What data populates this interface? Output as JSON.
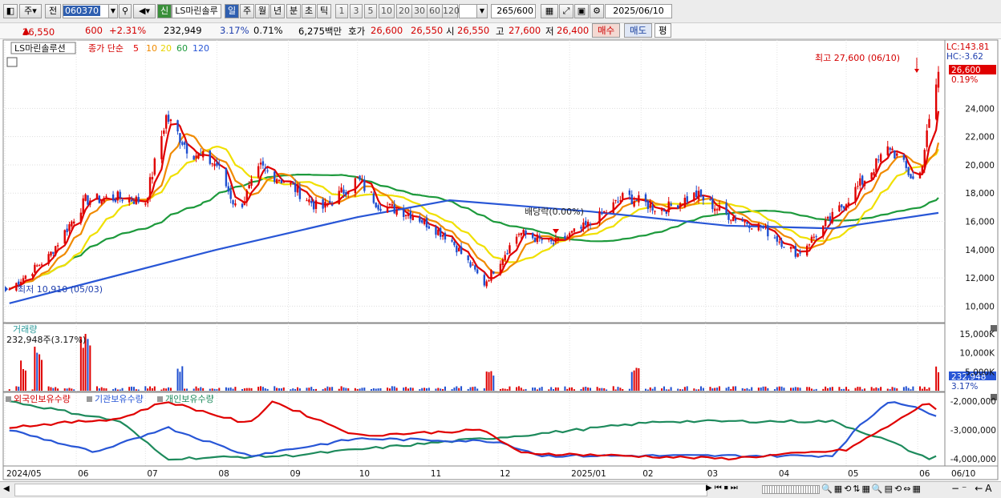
{
  "toolbar": {
    "period": "주",
    "prev": "전",
    "code": "060370",
    "new_badge": "신",
    "stock_name": "LS마린솔루",
    "tf_day": "일",
    "tf_week": "주",
    "tf_month": "월",
    "tf_year": "년",
    "tf_min": "분",
    "tf_sec": "초",
    "tf_tick": "틱",
    "nums": [
      "1",
      "3",
      "5",
      "10",
      "20",
      "30",
      "60",
      "120"
    ],
    "count": "265",
    "count_total": "/600",
    "date": "2025/06/10"
  },
  "quote": {
    "price": "26,550",
    "change": "600",
    "change_pct": "+2.31%",
    "volume": "232,949",
    "vol_pct": "3.17%",
    "turnover": "0.71%",
    "amount": "6,275백만",
    "bid_label": "호가",
    "bid1": "26,600",
    "bid2": "26,550",
    "open_label": "시",
    "open": "26,550",
    "high_label": "고",
    "high": "27,600",
    "low_label": "저",
    "low": "26,400",
    "buy": "매수",
    "sell": "매도",
    "eval": "평"
  },
  "price_pane": {
    "title": "LS마린솔루션",
    "ma_label": "종가 단순",
    "ma_periods": [
      "5",
      "10",
      "20",
      "60",
      "120"
    ],
    "lc": "LC:143.81",
    "hc": "HC:-3.62",
    "last_price": "26,600",
    "last_pct": "0.19%",
    "max_note": "최고 27,600 (06/10)",
    "min_note": "최저 10,910 (05/03)",
    "dividend_note": "배당락(0.00%)",
    "y_ticks": [
      "24,000",
      "22,000",
      "20,000",
      "18,000",
      "16,000",
      "14,000",
      "12,000",
      "10,000"
    ]
  },
  "volume_pane": {
    "title": "거래량",
    "value": "232,948주(3.17%)",
    "y_ticks": [
      "15,000K",
      "10,000K",
      "5,000K"
    ],
    "last": "232,948",
    "last_pct": "3.17%"
  },
  "holdings_pane": {
    "legend": [
      "외국인보유수량",
      "기관보유수량",
      "개인보유수량"
    ],
    "y_ticks": [
      "-2,000,000",
      "-3,000,000",
      "-4,000,000"
    ]
  },
  "x_axis": [
    "2024/05",
    "06",
    "07",
    "08",
    "09",
    "10",
    "11",
    "12",
    "2025/01",
    "02",
    "03",
    "04",
    "05",
    "06",
    "06/10"
  ],
  "colors": {
    "up": "#e00000",
    "down": "#1f4fd0",
    "ma5": "#e00000",
    "ma10": "#f08a00",
    "ma20": "#f0e000",
    "ma60": "#1d9a3c",
    "ma120": "#2856d6",
    "foreign": "#e00000",
    "institution": "#2856d6",
    "individual": "#1d8a5c"
  },
  "chart_data": {
    "type": "line",
    "x_range": [
      "2024/05",
      "2025/06/10"
    ],
    "price_ylim": [
      9000,
      28500
    ],
    "close_series": [
      [
        "2024-05-03",
        11200
      ],
      [
        "2024-05-20",
        13500
      ],
      [
        "2024-06-05",
        17500
      ],
      [
        "2024-06-20",
        17700
      ],
      [
        "2024-07-01",
        17400
      ],
      [
        "2024-07-10",
        23400
      ],
      [
        "2024-07-20",
        21000
      ],
      [
        "2024-08-01",
        20000
      ],
      [
        "2024-08-10",
        16700
      ],
      [
        "2024-08-20",
        19800
      ],
      [
        "2024-09-01",
        18700
      ],
      [
        "2024-09-15",
        16800
      ],
      [
        "2024-10-01",
        19000
      ],
      [
        "2024-10-10",
        17200
      ],
      [
        "2024-10-25",
        16500
      ],
      [
        "2024-11-10",
        14800
      ],
      [
        "2024-11-25",
        11600
      ],
      [
        "2024-12-10",
        15200
      ],
      [
        "2024-12-25",
        14400
      ],
      [
        "2025-01-10",
        15800
      ],
      [
        "2025-01-25",
        17800
      ],
      [
        "2025-02-10",
        16800
      ],
      [
        "2025-02-25",
        17900
      ],
      [
        "2025-03-10",
        16500
      ],
      [
        "2025-03-25",
        15600
      ],
      [
        "2025-04-10",
        13700
      ],
      [
        "2025-04-25",
        16300
      ],
      [
        "2025-05-10",
        19200
      ],
      [
        "2025-05-20",
        21300
      ],
      [
        "2025-06-01",
        18500
      ],
      [
        "2025-06-10",
        26550
      ]
    ],
    "ma60": [
      [
        "2024-05-03",
        10300
      ],
      [
        "2024-08-01",
        18600
      ],
      [
        "2024-10-01",
        19000
      ],
      [
        "2024-11-25",
        16400
      ],
      [
        "2025-01-10",
        14700
      ],
      [
        "2025-03-10",
        16200
      ],
      [
        "2025-04-25",
        16100
      ],
      [
        "2025-06-10",
        17400
      ]
    ],
    "ma120": [
      [
        "2024-05-03",
        10200
      ],
      [
        "2024-08-01",
        14000
      ],
      [
        "2024-10-01",
        16300
      ],
      [
        "2024-11-10",
        17500
      ],
      [
        "2025-01-10",
        16700
      ],
      [
        "2025-03-10",
        15700
      ],
      [
        "2025-04-25",
        15500
      ],
      [
        "2025-06-10",
        16600
      ]
    ],
    "volume_ylim_k": [
      0,
      16000
    ],
    "volume_peaks_k": [
      [
        "2024-05-10",
        8500
      ],
      [
        "2024-05-16",
        12000
      ],
      [
        "2024-06-05",
        16000
      ],
      [
        "2024-07-15",
        8000
      ],
      [
        "2024-11-28",
        6000
      ],
      [
        "2025-01-30",
        7500
      ],
      [
        "2025-06-10",
        7800
      ]
    ],
    "holdings_ylim": [
      -4200000,
      -1800000
    ],
    "foreign": [
      [
        "2024-05-03",
        -2900000
      ],
      [
        "2024-06-20",
        -2600000
      ],
      [
        "2024-07-10",
        -2000000
      ],
      [
        "2024-08-15",
        -2800000
      ],
      [
        "2024-08-25",
        -2000000
      ],
      [
        "2024-10-01",
        -3200000
      ],
      [
        "2024-11-25",
        -3000000
      ],
      [
        "2024-12-10",
        -3800000
      ],
      [
        "2025-03-10",
        -4000000
      ],
      [
        "2025-05-01",
        -3700000
      ],
      [
        "2025-05-25",
        -2600000
      ],
      [
        "2025-06-05",
        -2000000
      ],
      [
        "2025-06-10",
        -2400000
      ]
    ],
    "institution": [
      [
        "2024-05-03",
        -3000000
      ],
      [
        "2024-06-10",
        -3800000
      ],
      [
        "2024-07-10",
        -2900000
      ],
      [
        "2024-08-15",
        -3900000
      ],
      [
        "2024-10-01",
        -3300000
      ],
      [
        "2024-12-01",
        -3400000
      ],
      [
        "2024-12-20",
        -3900000
      ],
      [
        "2025-04-25",
        -3900000
      ],
      [
        "2025-05-05",
        -3000000
      ],
      [
        "2025-05-20",
        -1950000
      ],
      [
        "2025-06-10",
        -2500000
      ]
    ],
    "individual": [
      [
        "2024-05-03",
        -2000000
      ],
      [
        "2024-06-20",
        -2700000
      ],
      [
        "2024-07-10",
        -4000000
      ],
      [
        "2024-09-01",
        -3900000
      ],
      [
        "2024-11-10",
        -3400000
      ],
      [
        "2024-12-10",
        -3200000
      ],
      [
        "2025-02-10",
        -2700000
      ],
      [
        "2025-04-25",
        -2700000
      ],
      [
        "2025-05-20",
        -3400000
      ],
      [
        "2025-06-05",
        -4000000
      ],
      [
        "2025-06-10",
        -3900000
      ]
    ]
  }
}
